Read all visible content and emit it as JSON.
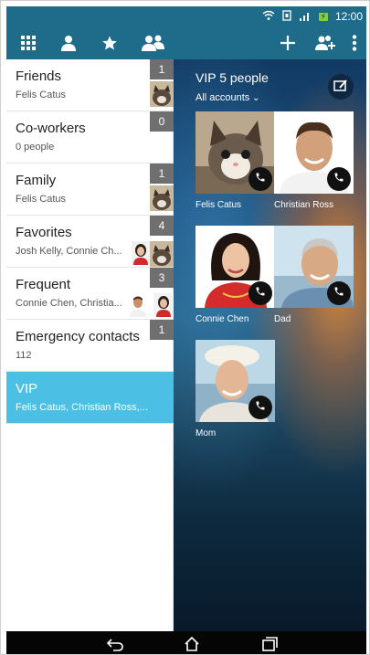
{
  "status_bar": {
    "time": "12:00",
    "icons": [
      "wifi-icon",
      "sim-icon",
      "signal-icon",
      "battery-charging-icon"
    ]
  },
  "toolbar": {
    "left_tabs": [
      "apps-grid-icon",
      "person-icon",
      "star-icon",
      "groups-icon"
    ],
    "right_actions": [
      "add-icon",
      "add-group-icon",
      "overflow-menu-icon"
    ]
  },
  "groups": [
    {
      "name": "Friends",
      "subtitle": "Felis Catus",
      "count": "1"
    },
    {
      "name": "Co-workers",
      "subtitle": "0 people",
      "count": "0"
    },
    {
      "name": "Family",
      "subtitle": "Felis Catus",
      "count": "1"
    },
    {
      "name": "Favorites",
      "subtitle": "Josh Kelly, Connie Ch...",
      "count": "4"
    },
    {
      "name": "Frequent",
      "subtitle": "Connie Chen, Christia...",
      "count": "3"
    },
    {
      "name": "Emergency contacts",
      "subtitle": "112",
      "count": "1"
    },
    {
      "name": "VIP",
      "subtitle": "Felis Catus, Christian Ross,...",
      "count": ""
    }
  ],
  "vip": {
    "title": "VIP 5 people",
    "accounts": "All accounts",
    "contacts": [
      {
        "name": "Felis Catus"
      },
      {
        "name": "Christian Ross"
      },
      {
        "name": "Connie Chen"
      },
      {
        "name": "Dad"
      },
      {
        "name": "Mom"
      }
    ]
  },
  "colors": {
    "toolbar": "#1f6b8a",
    "selected_group": "#4cc0e4",
    "count_badge": "#6f6f6f"
  }
}
